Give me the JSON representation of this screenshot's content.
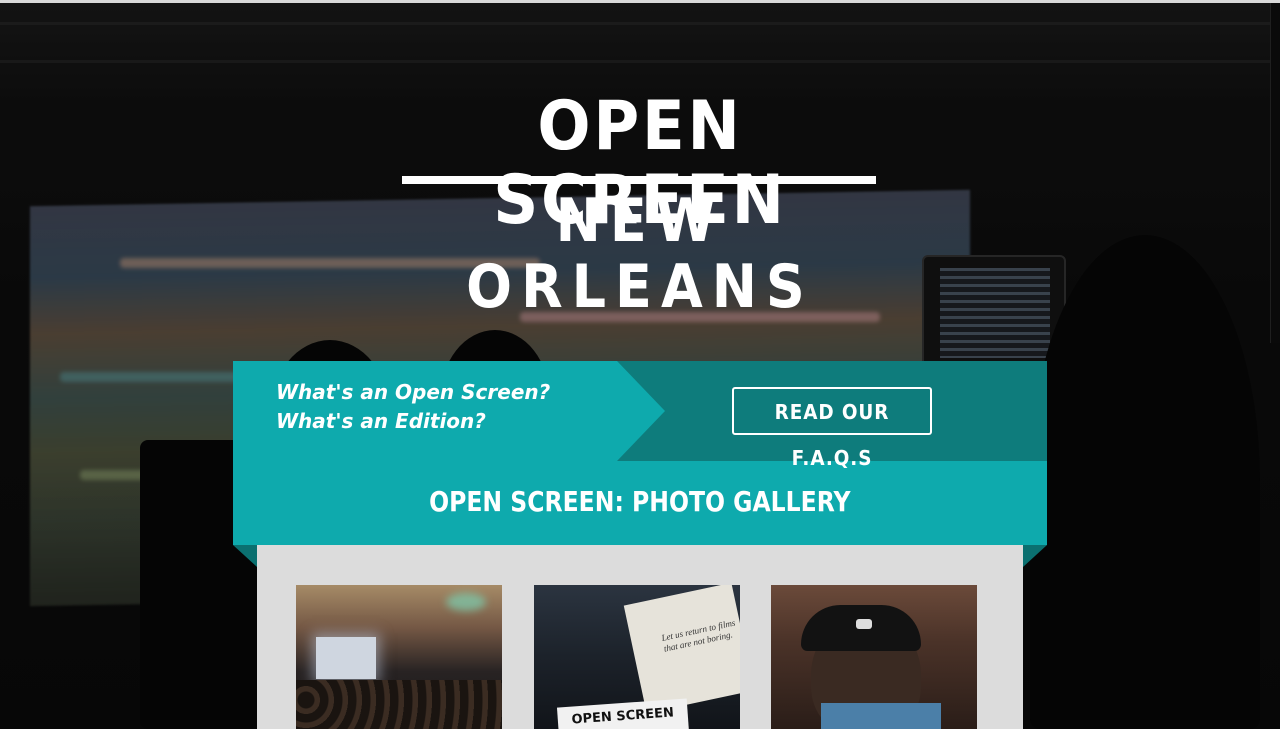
{
  "logo": {
    "line1": "OPEN SCREEN",
    "line2": "NEW ORLEANS"
  },
  "faq": {
    "question1": "What's an Open Screen?",
    "question2": "What's an Edition?",
    "button_label": "READ OUR F.A.Q.S"
  },
  "gallery": {
    "title": "OPEN SCREEN: PHOTO GALLERY",
    "photos": [
      {
        "subject": "audience watching a projected film"
      },
      {
        "subject": "open screen sign and card",
        "sign_text": "OPEN SCREEN",
        "card_text": "Let us return to films that are not boring."
      },
      {
        "subject": "man in cap in crowd"
      }
    ]
  },
  "colors": {
    "teal": "#0eaaad",
    "teal_dark": "#0e7c7c",
    "panel": "#dcdcdc",
    "text": "#ffffff"
  }
}
